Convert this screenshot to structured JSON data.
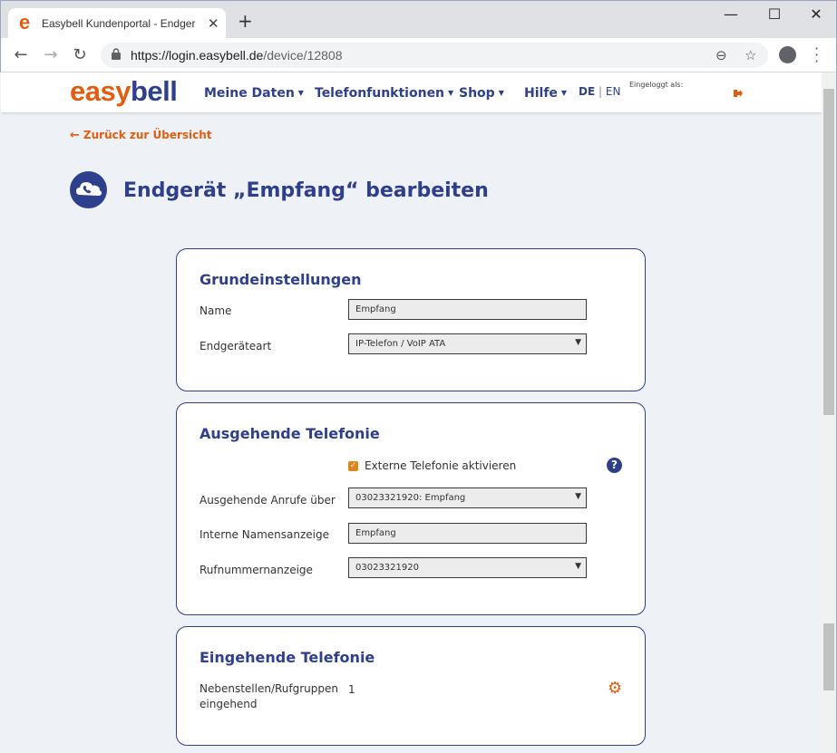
{
  "browser": {
    "tab_title": "Easybell Kundenportal - Endgerä",
    "favicon": "e",
    "url_host": "https://login.easybell.de",
    "url_path": "/device/12808"
  },
  "header": {
    "logo_easy": "easy",
    "logo_bell": "bell",
    "nav": [
      {
        "label": "Meine Daten"
      },
      {
        "label": "Telefonfunktionen"
      },
      {
        "label": "Shop"
      },
      {
        "label": "Hilfe"
      }
    ],
    "lang_de": "DE",
    "lang_sep": "|",
    "lang_en": "EN",
    "logged_in_label": "Eingeloggt als:"
  },
  "back_link": "Zurück zur Übersicht",
  "page_title": "Endgerät „Empfang“ bearbeiten",
  "grundeinstellungen": {
    "title": "Grundeinstellungen",
    "name_label": "Name",
    "name_value": "Empfang",
    "type_label": "Endgeräteart",
    "type_value": "IP-Telefon / VoIP ATA"
  },
  "ausgehend": {
    "title": "Ausgehende Telefonie",
    "extern_label": "Externe Telefonie aktivieren",
    "extern_checked": true,
    "calls_label": "Ausgehende Anrufe über",
    "calls_value": "03023321920: Empfang",
    "intern_label": "Interne Namensanzeige",
    "intern_value": "Empfang",
    "number_label": "Rufnummernanzeige",
    "number_value": "03023321920"
  },
  "eingehend": {
    "title": "Eingehende Telefonie",
    "ext_label_1": "Nebenstellen/Rufgruppen",
    "ext_label_2": "eingehend",
    "ext_value": "1"
  },
  "colors": {
    "brand_orange": "#e35d10",
    "brand_blue": "#2e3f8d",
    "background": "#eef1f5"
  }
}
